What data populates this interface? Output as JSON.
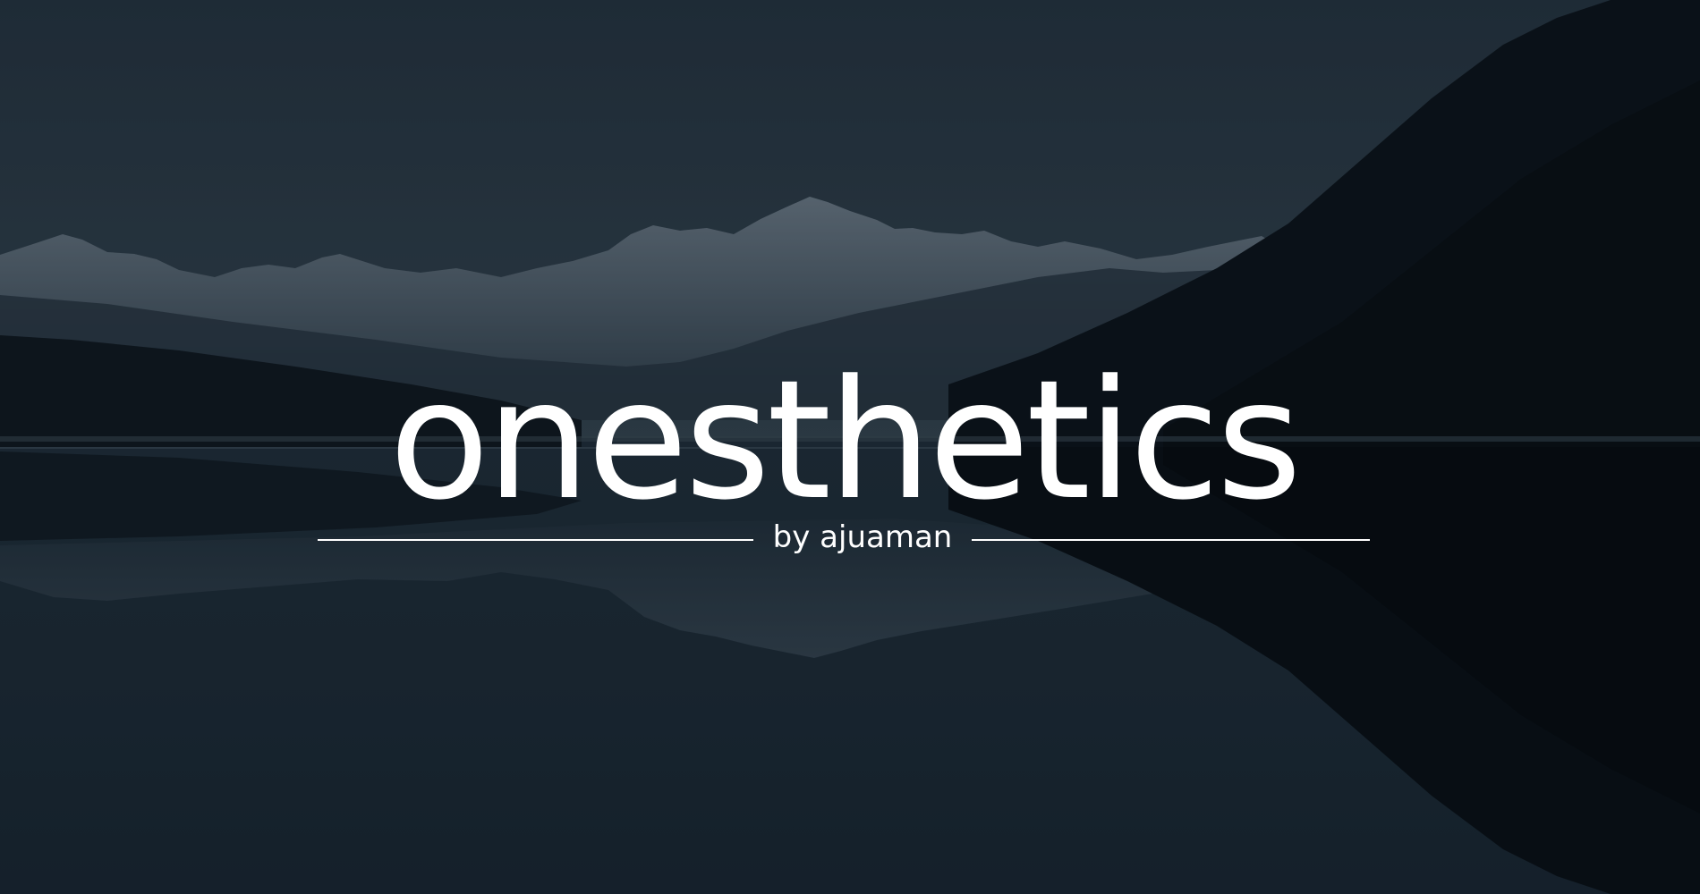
{
  "logo": {
    "wordmark": "onesthetics",
    "byline": "by ajuaman",
    "text_color": "#ffffff"
  },
  "background": {
    "subject": "mountain-lake-reflection",
    "sky_color": "#2b3a46",
    "water_color": "#1a2733",
    "shadow_color": "#05090d"
  }
}
